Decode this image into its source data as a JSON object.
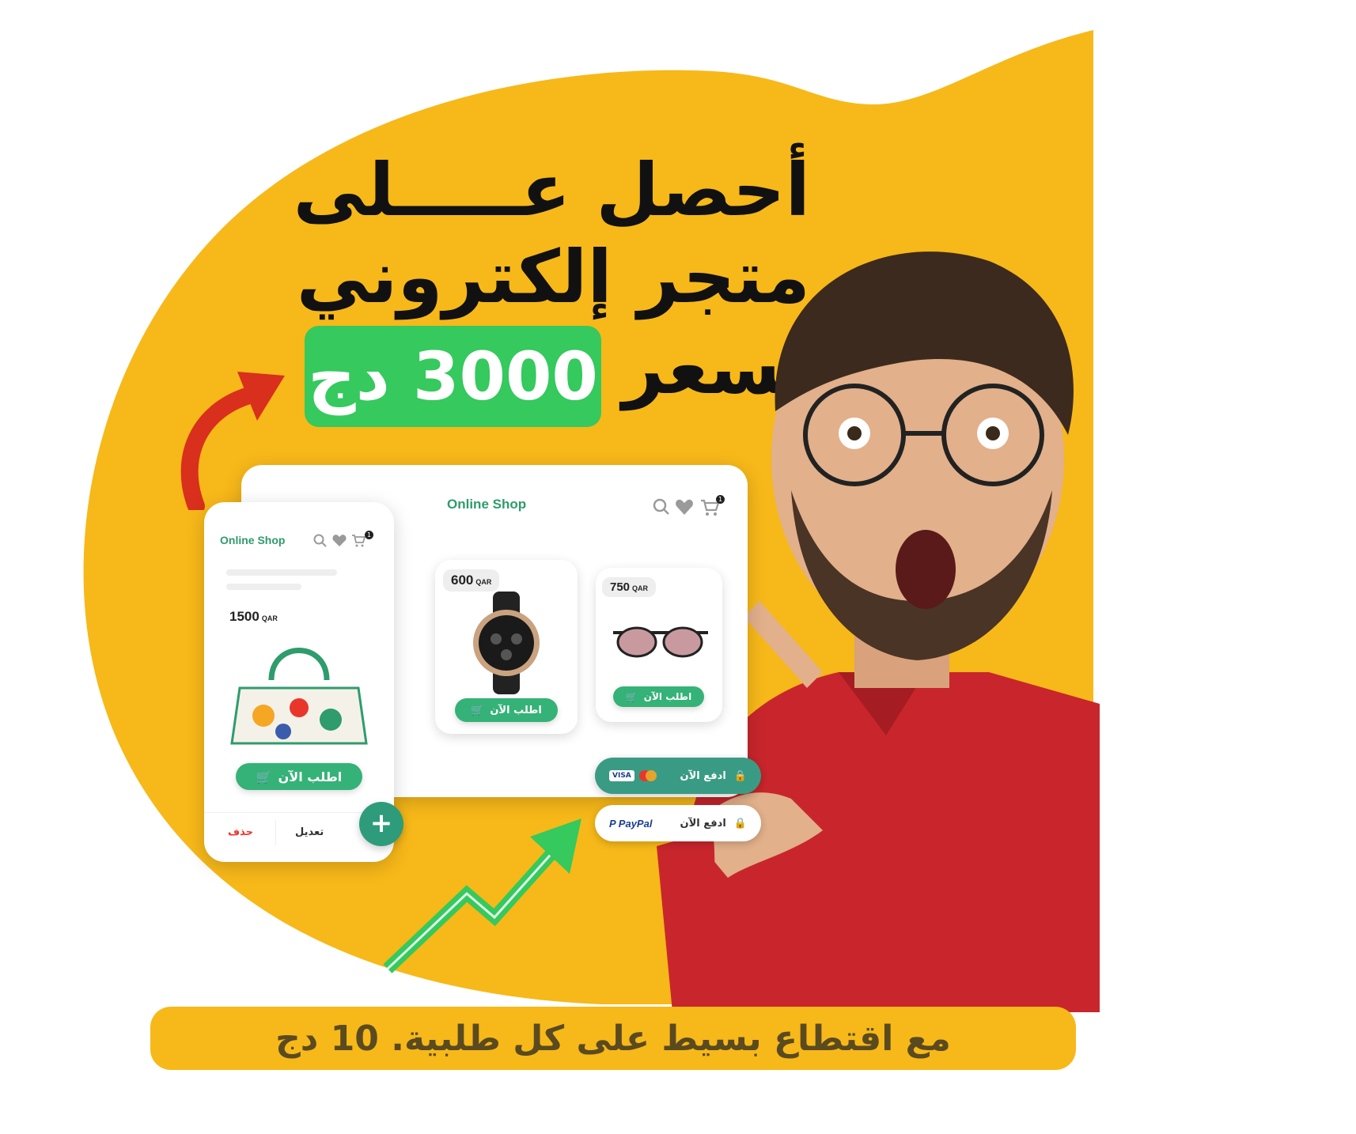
{
  "colors": {
    "background_blob": "#f7b819",
    "price_pill": "#35c95e",
    "shop_green": "#2e9c6c",
    "arrow_red": "#d8301c",
    "arrow_green": "#35c95e",
    "shirt_red": "#c8262c"
  },
  "headline": {
    "line1": "أحصل عـــــلى",
    "line2": "متجر إلكتروني",
    "line3": "بسعر",
    "price": "3000 دج"
  },
  "desktop": {
    "shop_title": "Online Shop",
    "cart_count": "1",
    "products": [
      {
        "price": "600",
        "currency": "QAR",
        "order_label": "اطلب الآن",
        "icon": "watch"
      },
      {
        "price": "750",
        "currency": "QAR",
        "order_label": "اطلب الآن",
        "icon": "sunglasses"
      }
    ],
    "pay_buttons": [
      {
        "label": "ادفع الآن",
        "method": "VISA / Mastercard"
      },
      {
        "label": "ادفع الآن",
        "method": "PayPal"
      }
    ]
  },
  "mobile": {
    "shop_title": "Online Shop",
    "cart_count": "1",
    "product": {
      "price": "1500",
      "currency": "QAR",
      "order_label": "اطلب الآن",
      "icon": "handbag"
    },
    "edit_label": "تعديل",
    "delete_label": "حذف",
    "add_symbol": "+"
  },
  "footer": {
    "text": "مع اقتطاع بسيط على كل طلبية. 10 دج"
  }
}
